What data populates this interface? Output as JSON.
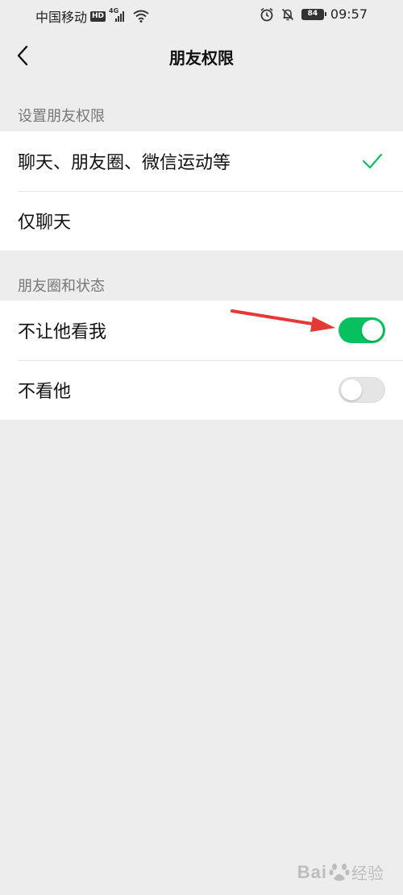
{
  "status_bar": {
    "carrier": "中国移动",
    "hd_badge": "HD",
    "network": "4G",
    "battery": "84",
    "time": "09:57",
    "icons": [
      "hd-icon",
      "signal-icon",
      "wifi-icon",
      "alarm-icon",
      "mute-icon",
      "battery-icon"
    ]
  },
  "nav": {
    "title": "朋友权限",
    "back_icon": "chevron-left-icon"
  },
  "section1": {
    "header": "设置朋友权限",
    "options": [
      {
        "label": "聊天、朋友圈、微信运动等",
        "selected": true
      },
      {
        "label": "仅聊天",
        "selected": false
      }
    ]
  },
  "section2": {
    "header": "朋友圈和状态",
    "toggles": [
      {
        "label": "不让他看我",
        "on": true
      },
      {
        "label": "不看他",
        "on": false
      }
    ]
  },
  "watermark": {
    "brand": "Bai",
    "suffix": "经验"
  },
  "colors": {
    "accent_green": "#07c160",
    "background": "#ededed",
    "annotation_red": "#e53935"
  }
}
